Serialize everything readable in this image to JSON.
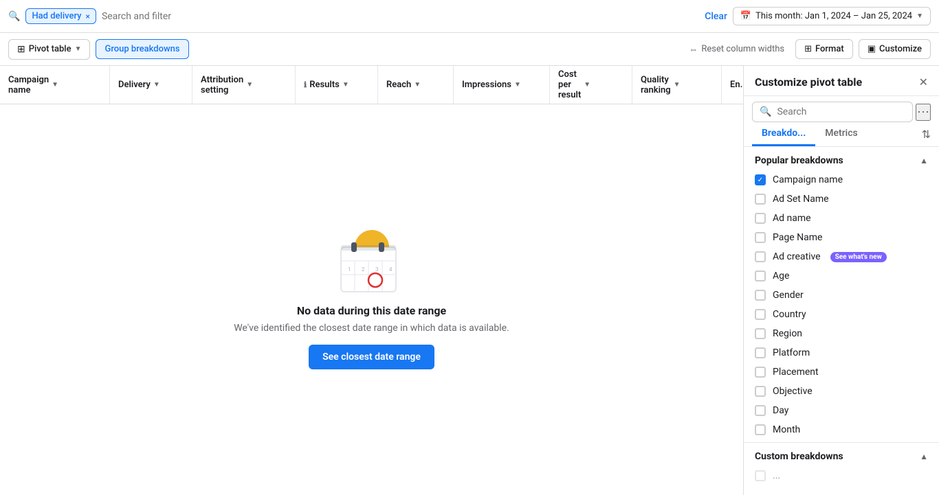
{
  "topbar": {
    "filter_label": "Had delivery",
    "filter_close": "×",
    "search_placeholder": "Search and filter",
    "clear_label": "Clear",
    "date_range": "This month: Jan 1, 2024 – Jan 25, 2024"
  },
  "toolbar": {
    "pivot_table_label": "Pivot table",
    "group_breakdowns_label": "Group breakdowns",
    "reset_columns_label": "Reset column widths",
    "format_label": "Format",
    "customize_label": "Customize"
  },
  "table": {
    "columns": [
      {
        "id": "campaign",
        "label": "Campaign name"
      },
      {
        "id": "delivery",
        "label": "Delivery"
      },
      {
        "id": "attribution",
        "label": "Attribution setting"
      },
      {
        "id": "results",
        "label": "Results"
      },
      {
        "id": "reach",
        "label": "Reach"
      },
      {
        "id": "impressions",
        "label": "Impressions"
      },
      {
        "id": "cost",
        "label": "Cost per result"
      },
      {
        "id": "quality",
        "label": "Quality ranking"
      },
      {
        "id": "eng",
        "label": "En..."
      }
    ]
  },
  "empty_state": {
    "title": "No data during this date range",
    "subtitle": "We've identified the closest date range in which data is available.",
    "button_label": "See closest date range"
  },
  "right_panel": {
    "title": "Customize pivot table",
    "search_placeholder": "Search",
    "tabs": [
      {
        "id": "breakdowns",
        "label": "Breakdo..."
      },
      {
        "id": "metrics",
        "label": "Metrics"
      }
    ],
    "popular_section_title": "Popular breakdowns",
    "popular_items": [
      {
        "id": "campaign_name",
        "label": "Campaign name",
        "checked": true
      },
      {
        "id": "ad_set_name",
        "label": "Ad Set Name",
        "checked": false
      },
      {
        "id": "ad_name",
        "label": "Ad name",
        "checked": false
      },
      {
        "id": "page_name",
        "label": "Page Name",
        "checked": false
      },
      {
        "id": "ad_creative",
        "label": "Ad creative",
        "checked": false,
        "badge": "See what's new"
      },
      {
        "id": "age",
        "label": "Age",
        "checked": false
      },
      {
        "id": "gender",
        "label": "Gender",
        "checked": false
      },
      {
        "id": "country",
        "label": "Country",
        "checked": false
      },
      {
        "id": "region",
        "label": "Region",
        "checked": false
      },
      {
        "id": "platform",
        "label": "Platform",
        "checked": false
      },
      {
        "id": "placement",
        "label": "Placement",
        "checked": false
      },
      {
        "id": "objective",
        "label": "Objective",
        "checked": false
      },
      {
        "id": "day",
        "label": "Day",
        "checked": false
      },
      {
        "id": "month",
        "label": "Month",
        "checked": false
      }
    ],
    "custom_section_title": "Custom breakdowns"
  }
}
